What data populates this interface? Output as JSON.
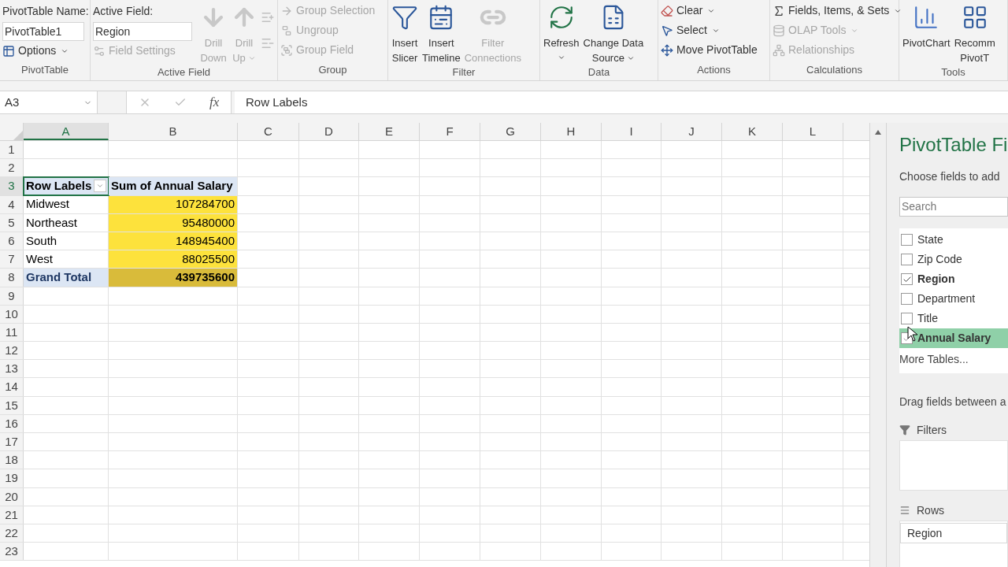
{
  "ribbon": {
    "groups": [
      {
        "label": "PivotTable",
        "columns": [
          [
            {
              "kind": "field",
              "label": "PivotTable Name:",
              "value": "PivotTable1"
            },
            {
              "kind": "small",
              "label": "Options",
              "disabled": false,
              "dropdown": true
            }
          ]
        ]
      },
      {
        "label": "Active Field",
        "columns": [
          [
            {
              "kind": "field",
              "label": "Active Field:",
              "value": "Region"
            },
            {
              "kind": "small",
              "label": "Field Settings",
              "disabled": true,
              "dropdown": false
            }
          ],
          [
            {
              "kind": "large",
              "lines": [
                "Drill",
                "Down"
              ],
              "disabled": true,
              "dropdown": false
            }
          ],
          [
            {
              "kind": "large",
              "lines": [
                "Drill",
                "Up"
              ],
              "disabled": true,
              "dropdown": true
            }
          ],
          [
            {
              "kind": "icon",
              "disabled": true
            },
            {
              "kind": "icon",
              "disabled": true
            }
          ]
        ]
      },
      {
        "label": "Group",
        "columns": [
          [
            {
              "kind": "small",
              "label": "Group Selection",
              "disabled": true,
              "dropdown": false
            },
            {
              "kind": "small",
              "label": "Ungroup",
              "disabled": true,
              "dropdown": false
            },
            {
              "kind": "small",
              "label": "Group Field",
              "disabled": true,
              "dropdown": false
            }
          ]
        ]
      },
      {
        "label": "Filter",
        "columns": [
          [
            {
              "kind": "large",
              "lines": [
                "Insert",
                "Slicer"
              ],
              "disabled": false,
              "dropdown": false
            }
          ],
          [
            {
              "kind": "large",
              "lines": [
                "Insert",
                "Timeline"
              ],
              "disabled": false,
              "dropdown": false
            }
          ],
          [
            {
              "kind": "large",
              "lines": [
                "Filter",
                "Connections"
              ],
              "disabled": true,
              "dropdown": false
            }
          ]
        ]
      },
      {
        "label": "Data",
        "columns": [
          [
            {
              "kind": "large",
              "lines": [
                "Refresh"
              ],
              "disabled": false,
              "dropdown": true
            }
          ],
          [
            {
              "kind": "large",
              "lines": [
                "Change Data",
                "Source"
              ],
              "disabled": false,
              "dropdown": true
            }
          ]
        ]
      },
      {
        "label": "Actions",
        "columns": [
          [
            {
              "kind": "small",
              "label": "Clear",
              "disabled": false,
              "dropdown": true
            },
            {
              "kind": "small",
              "label": "Select",
              "disabled": false,
              "dropdown": true
            },
            {
              "kind": "small",
              "label": "Move PivotTable",
              "disabled": false,
              "dropdown": false
            }
          ]
        ]
      },
      {
        "label": "Calculations",
        "columns": [
          [
            {
              "kind": "small",
              "label": "Fields, Items, & Sets",
              "disabled": false,
              "dropdown": true
            },
            {
              "kind": "small",
              "label": "OLAP Tools",
              "disabled": true,
              "dropdown": true
            },
            {
              "kind": "small",
              "label": "Relationships",
              "disabled": true,
              "dropdown": false
            }
          ]
        ]
      },
      {
        "label": "Tools",
        "columns": [
          [
            {
              "kind": "large",
              "lines": [
                "PivotChart"
              ],
              "disabled": false,
              "dropdown": false
            }
          ],
          [
            {
              "kind": "large",
              "lines": [
                "Recomm",
                "PivotT"
              ],
              "disabled": false,
              "dropdown": false
            }
          ]
        ]
      }
    ]
  },
  "formula_bar": {
    "name_box": "A3",
    "function_label": "fx",
    "content": "Row Labels"
  },
  "sheet": {
    "columns": [
      {
        "label": "A",
        "selected": true
      },
      {
        "label": "B",
        "selected": false
      },
      {
        "label": "C",
        "selected": false
      },
      {
        "label": "D",
        "selected": false
      },
      {
        "label": "E",
        "selected": false
      },
      {
        "label": "F",
        "selected": false
      },
      {
        "label": "G",
        "selected": false
      },
      {
        "label": "H",
        "selected": false
      },
      {
        "label": "I",
        "selected": false
      },
      {
        "label": "J",
        "selected": false
      },
      {
        "label": "K",
        "selected": false
      },
      {
        "label": "L",
        "selected": false
      }
    ],
    "rows": [
      {
        "number": "1",
        "selected": false
      },
      {
        "number": "2",
        "selected": false
      },
      {
        "number": "3",
        "selected": true,
        "cells": [
          {
            "kind": "header",
            "text": "Row Labels",
            "selected": true,
            "filter_button": true
          },
          {
            "kind": "header",
            "text": "Sum of Annual Salary",
            "selected": false,
            "filter_button": false
          }
        ]
      },
      {
        "number": "4",
        "selected": false,
        "cells": [
          {
            "kind": "item",
            "text": "Midwest",
            "selected": false,
            "filter_button": false
          },
          {
            "kind": "value",
            "text": "107284700",
            "selected": false,
            "filter_button": false
          }
        ]
      },
      {
        "number": "5",
        "selected": false,
        "cells": [
          {
            "kind": "item",
            "text": "Northeast",
            "selected": false,
            "filter_button": false
          },
          {
            "kind": "value",
            "text": "95480000",
            "selected": false,
            "filter_button": false
          }
        ]
      },
      {
        "number": "6",
        "selected": false,
        "cells": [
          {
            "kind": "item",
            "text": "South",
            "selected": false,
            "filter_button": false
          },
          {
            "kind": "value",
            "text": "148945400",
            "selected": false,
            "filter_button": false
          }
        ]
      },
      {
        "number": "7",
        "selected": false,
        "cells": [
          {
            "kind": "item",
            "text": "West",
            "selected": false,
            "filter_button": false
          },
          {
            "kind": "value",
            "text": "88025500",
            "selected": false,
            "filter_button": false
          }
        ]
      },
      {
        "number": "8",
        "selected": false,
        "cells": [
          {
            "kind": "total_label",
            "text": "Grand Total",
            "selected": false,
            "filter_button": false
          },
          {
            "kind": "total_value",
            "text": "439735600",
            "selected": false,
            "filter_button": false
          }
        ]
      },
      {
        "number": "9",
        "selected": false
      },
      {
        "number": "10",
        "selected": false
      },
      {
        "number": "11",
        "selected": false
      },
      {
        "number": "12",
        "selected": false
      },
      {
        "number": "13",
        "selected": false
      },
      {
        "number": "14",
        "selected": false
      },
      {
        "number": "15",
        "selected": false
      },
      {
        "number": "16",
        "selected": false
      },
      {
        "number": "17",
        "selected": false
      },
      {
        "number": "18",
        "selected": false
      },
      {
        "number": "19",
        "selected": false
      },
      {
        "number": "20",
        "selected": false
      },
      {
        "number": "21",
        "selected": false
      },
      {
        "number": "22",
        "selected": false
      },
      {
        "number": "23",
        "selected": false
      }
    ]
  },
  "field_pane": {
    "title": "PivotTable Fi",
    "subtitle": "Choose fields to add",
    "search_placeholder": "Search",
    "fields": [
      {
        "label": "State",
        "checked": false,
        "hovered": false
      },
      {
        "label": "Zip Code",
        "checked": false,
        "hovered": false
      },
      {
        "label": "Region",
        "checked": true,
        "hovered": false
      },
      {
        "label": "Department",
        "checked": false,
        "hovered": false
      },
      {
        "label": "Title",
        "checked": false,
        "hovered": false
      },
      {
        "label": "Annual Salary",
        "checked": true,
        "hovered": true
      }
    ],
    "more_tables": "More Tables...",
    "drag_hint": "Drag fields between a",
    "areas": [
      {
        "kind": "filters",
        "label": "Filters"
      },
      {
        "kind": "rows",
        "label": "Rows",
        "items": [
          "Region"
        ]
      }
    ]
  }
}
